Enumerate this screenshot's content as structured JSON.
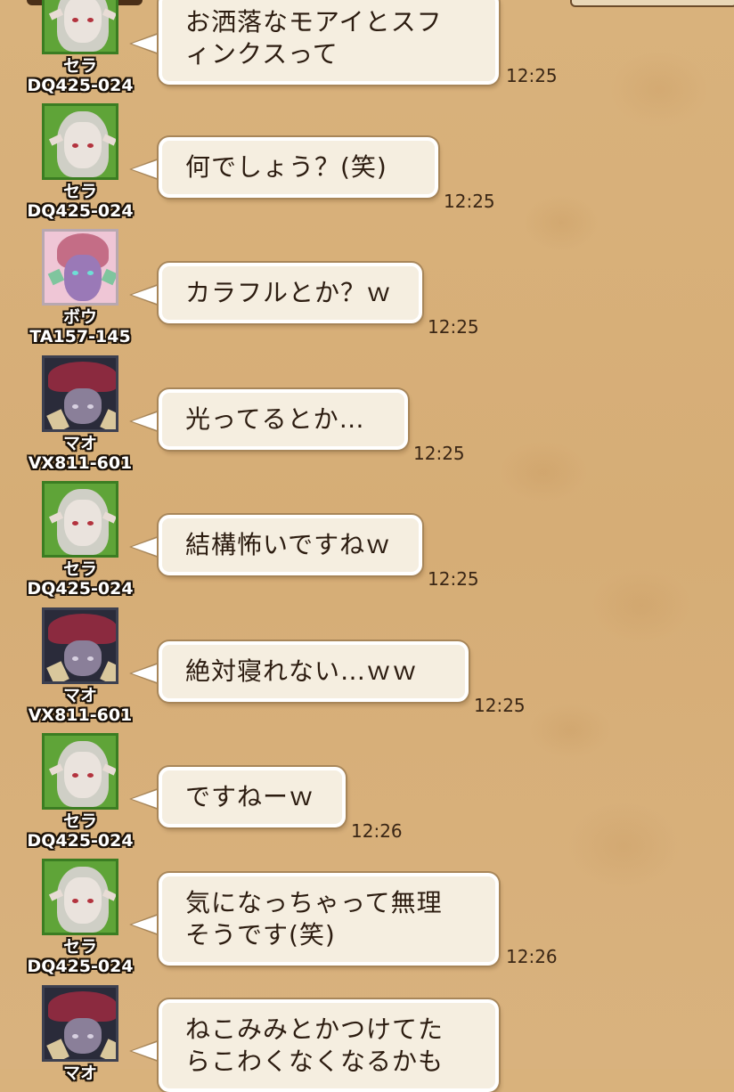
{
  "messages": [
    {
      "char": "セラ",
      "id": "DQ425-024",
      "avatar": "sera-avatar",
      "text": "お洒落なモアイとスフ\nィンクスって",
      "time": "12:25"
    },
    {
      "char": "セラ",
      "id": "DQ425-024",
      "avatar": "sera-avatar",
      "text": "何でしょう？(笑)",
      "time": "12:25"
    },
    {
      "char": "ボウ",
      "id": "TA157-145",
      "avatar": "bou-avatar",
      "text": "カラフルとか？ｗ",
      "time": "12:25"
    },
    {
      "char": "マオ",
      "id": "VX811-601",
      "avatar": "mao-avatar",
      "text": "光ってるとか…",
      "time": "12:25"
    },
    {
      "char": "セラ",
      "id": "DQ425-024",
      "avatar": "sera-avatar",
      "text": "結構怖いですねｗ",
      "time": "12:25"
    },
    {
      "char": "マオ",
      "id": "VX811-601",
      "avatar": "mao-avatar",
      "text": "絶対寝れない…ｗｗ",
      "time": "12:25"
    },
    {
      "char": "セラ",
      "id": "DQ425-024",
      "avatar": "sera-avatar",
      "text": "ですねーｗ",
      "time": "12:26"
    },
    {
      "char": "セラ",
      "id": "DQ425-024",
      "avatar": "sera-avatar",
      "text": "気になっちゃって無理\nそうです(笑)",
      "time": "12:26"
    },
    {
      "char": "マオ",
      "id": "VX811-601",
      "avatar": "mao-avatar",
      "text": "ねこみみとかつけてた\nらこわくなくなるかも",
      "time": ""
    }
  ],
  "colors": {
    "background": "#d9b27c",
    "bubble": "#f5eee0",
    "bubble_border": "#ffffff",
    "name_text": "#ffffff",
    "time_text": "#3a2615"
  }
}
